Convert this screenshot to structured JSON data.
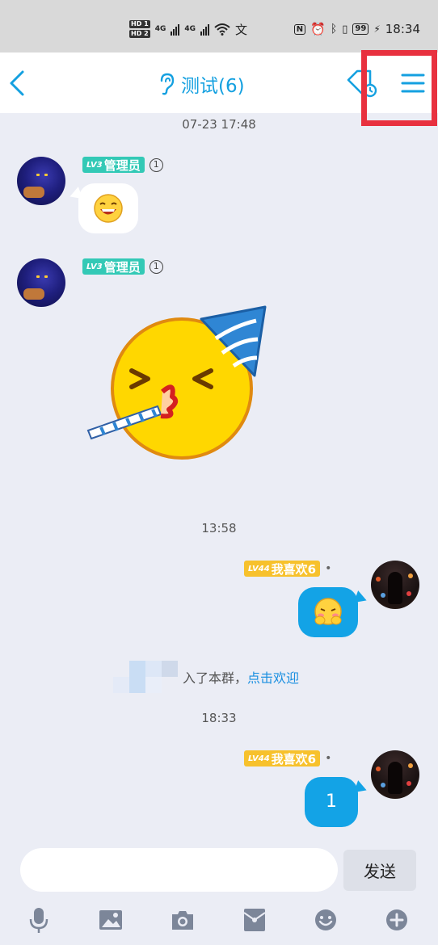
{
  "status_bar": {
    "sim1": "HD 1",
    "sim2": "HD 2",
    "network1": "4G",
    "network2": "4G",
    "battery": "99",
    "time": "18:34"
  },
  "header": {
    "title": "测试(6)",
    "icons": [
      "back-icon",
      "ear-icon",
      "tag-icon",
      "menu-icon"
    ]
  },
  "messages": [
    {
      "type": "time",
      "text": "07-23 17:48"
    },
    {
      "type": "received",
      "level": "LV3",
      "sender": "管理员",
      "content": "laughing-face-emoji"
    },
    {
      "type": "received",
      "level": "LV3",
      "sender": "管理员",
      "content": "party-face-sticker"
    },
    {
      "type": "time",
      "text": "13:58"
    },
    {
      "type": "sent",
      "level": "LV44",
      "sender": "我喜欢6",
      "content": "blushing-face-emoji"
    },
    {
      "type": "system",
      "joined_text": "入了本群，",
      "link_text": "点击欢迎"
    },
    {
      "type": "time",
      "text": "18:33"
    },
    {
      "type": "sent",
      "level": "LV44",
      "sender": "我喜欢6",
      "text": "1"
    }
  ],
  "input": {
    "placeholder": "",
    "value": "",
    "send_label": "发送"
  },
  "toolbar": [
    "microphone-icon",
    "image-icon",
    "camera-icon",
    "red-packet-icon",
    "emoji-icon",
    "plus-icon"
  ],
  "colors": {
    "accent": "#14a0e0",
    "bubble_blue": "#13a3e6",
    "badge_admin": "#33c9b6",
    "badge_member": "#f7c12c",
    "highlight_box": "#e8313f",
    "background": "#ebedf5"
  }
}
